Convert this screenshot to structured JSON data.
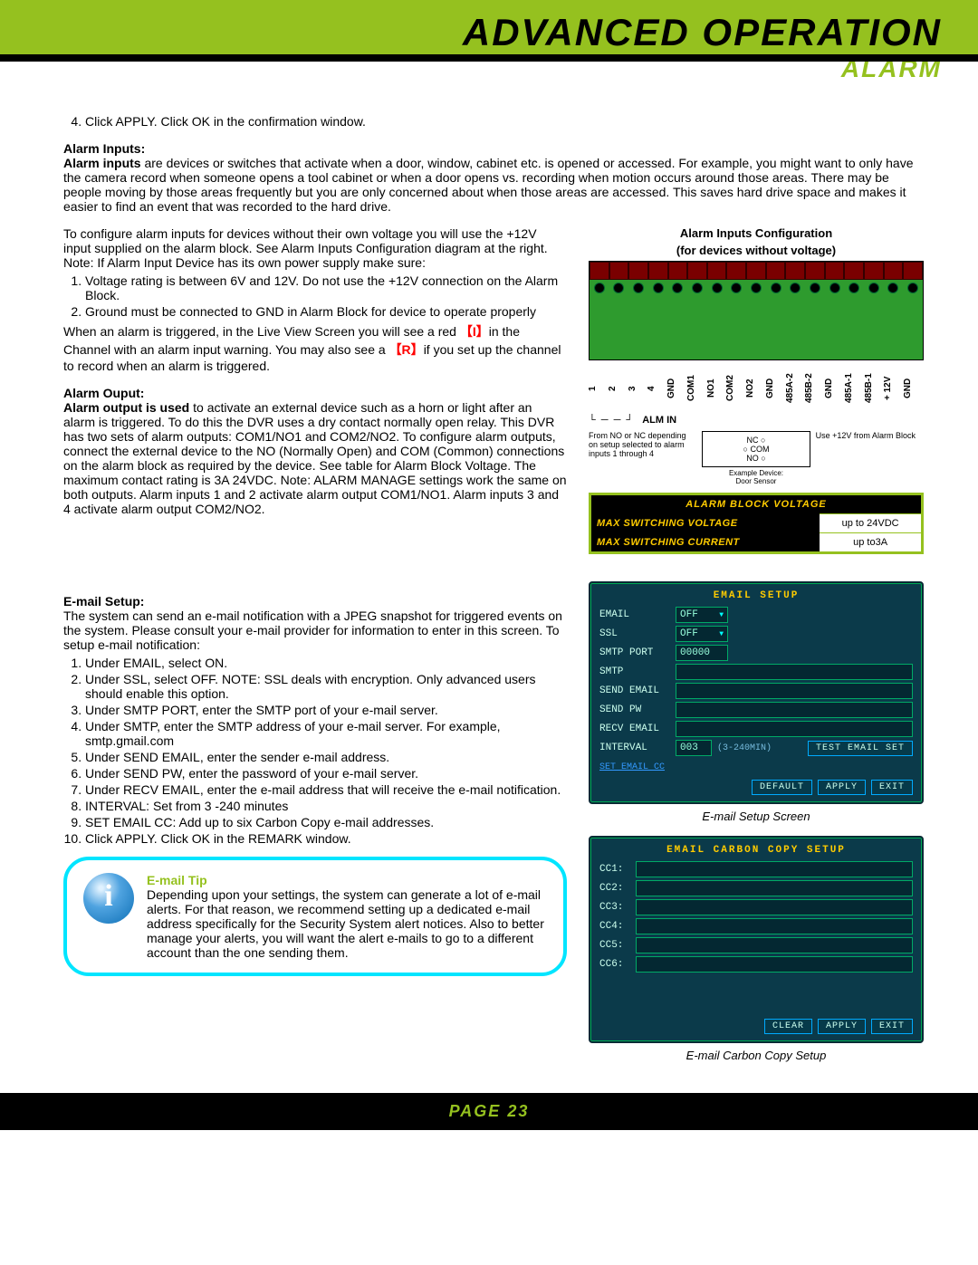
{
  "header": {
    "title": "ADVANCED OPERATION",
    "subtitle": "ALARM"
  },
  "intro_step": "Click APPLY. Click OK in the confirmation window.",
  "alarm_inputs": {
    "heading": "Alarm Inputs:",
    "lead": "Alarm inputs",
    "body": " are devices or switches that activate when a door, window, cabinet etc. is opened or accessed. For example, you might want to only have the camera record when someone opens a tool cabinet or when a door opens vs. recording when motion occurs around those areas. There may be people moving by those areas frequently but you are only concerned about when those areas are accessed. This saves hard drive space and makes it easier to find an event that was recorded to the hard drive.",
    "config_para": "To configure alarm inputs for devices without their own voltage you will use the +12V input supplied on the alarm block. See Alarm Inputs Configuration diagram at the right.",
    "note_line": "Note: If Alarm Input Device has its own power supply make sure:",
    "notes": [
      "Voltage rating is between 6V and 12V. Do not use the +12V connection on the Alarm Block.",
      "Ground must be connected to GND in Alarm Block for device to operate properly"
    ],
    "trigger1": "When an alarm is triggered, in the Live View Screen you will see a red ",
    "trigI": "【I】",
    "trigger2": "in the Channel with an alarm input warning. You may also see a ",
    "trigR": "【R】",
    "trigger3": "if you set up the channel to record when an alarm is triggered."
  },
  "alarm_output": {
    "heading": "Alarm Ouput:",
    "lead": "Alarm output is used",
    "body": " to activate an external device such as a horn or light after an alarm is triggered. To do this the DVR uses a dry contact normally open relay. This DVR has two sets of alarm outputs: COM1/NO1 and COM2/NO2. To configure alarm outputs, connect the external device to the NO (Normally Open) and COM (Common) connections on the alarm block as required by the device. See table for Alarm Block Voltage. The maximum contact rating is 3A 24VDC. Note: ALARM MANAGE settings work the same on both outputs. Alarm inputs 1 and 2 activate alarm output COM1/NO1. Alarm inputs 3 and 4 activate alarm output COM2/NO2."
  },
  "email_setup": {
    "heading": "E-mail Setup:",
    "intro": "The system can send an e-mail notification with a JPEG snapshot for triggered events on the system. Please consult your e-mail provider for information to enter in this screen. To setup e-mail notification:",
    "steps": [
      "Under EMAIL, select ON.",
      "Under SSL, select OFF. NOTE: SSL deals with encryption. Only advanced users should enable this option.",
      "Under SMTP PORT, enter the SMTP port of your e-mail server.",
      "Under SMTP, enter the SMTP address of your e-mail server. For example, smtp.gmail.com",
      "Under SEND EMAIL, enter the sender e-mail address.",
      "Under SEND PW, enter the password of your e-mail server.",
      "Under RECV EMAIL, enter the e-mail address that will receive the e-mail notification.",
      "INTERVAL: Set from 3 -240 minutes",
      "SET EMAIL CC: Add up to six Carbon Copy e-mail addresses.",
      "Click APPLY. Click OK in the REMARK window."
    ]
  },
  "tip": {
    "title": "E-mail Tip",
    "body": "Depending upon your settings, the system can generate a lot of e-mail alerts. For that reason, we recommend setting up a dedicated e-mail address specifically for the Security System alert notices. Also to better manage your alerts, you will want the alert e-mails to go to a different account than the one sending them."
  },
  "diagram": {
    "title1": "Alarm Inputs Configuration",
    "title2": "(for devices without voltage)",
    "pins": [
      "1",
      "2",
      "3",
      "4",
      "GND",
      "COM1",
      "NO1",
      "COM2",
      "NO2",
      "GND",
      "485A-2",
      "485B-2",
      "GND",
      "485A-1",
      "485B-1",
      "+ 12V",
      "GND"
    ],
    "alm_in": "ALM  IN",
    "foot_left": "From NO or NC depending on setup selected to alarm inputs 1 through 4",
    "sensor_nc": "NC",
    "sensor_no": "NO",
    "sensor_com": "COM",
    "sensor_label1": "Example Device:",
    "sensor_label2": "Door Sensor",
    "foot_right": "Use +12V from Alarm Block"
  },
  "vtable": {
    "header": "ALARM BLOCK VOLTAGE",
    "r1l": "MAX SWITCHING VOLTAGE",
    "r1r": "up to 24VDC",
    "r2l": "MAX SWITCHING CURRENT",
    "r2r": "up to3A"
  },
  "dvr1": {
    "title": "EMAIL SETUP",
    "rows": {
      "email": "EMAIL",
      "email_v": "OFF",
      "ssl": "SSL",
      "ssl_v": "OFF",
      "smtp_port": "SMTP PORT",
      "smtp_port_v": "00000",
      "smtp": "SMTP",
      "send_email": "SEND EMAIL",
      "send_pw": "SEND PW",
      "recv_email": "RECV EMAIL",
      "interval": "INTERVAL",
      "interval_v": "003",
      "interval_note": "(3-240MIN)",
      "interval_btn": "TEST EMAIL SET"
    },
    "link": "SET EMAIL CC",
    "btns": [
      "DEFAULT",
      "APPLY",
      "EXIT"
    ],
    "caption": "E-mail Setup Screen"
  },
  "dvr2": {
    "title": "EMAIL CARBON COPY SETUP",
    "cc": [
      "CC1:",
      "CC2:",
      "CC3:",
      "CC4:",
      "CC5:",
      "CC6:"
    ],
    "btns": [
      "CLEAR",
      "APPLY",
      "EXIT"
    ],
    "caption": "E-mail Carbon Copy Setup"
  },
  "footer": "PAGE 23"
}
